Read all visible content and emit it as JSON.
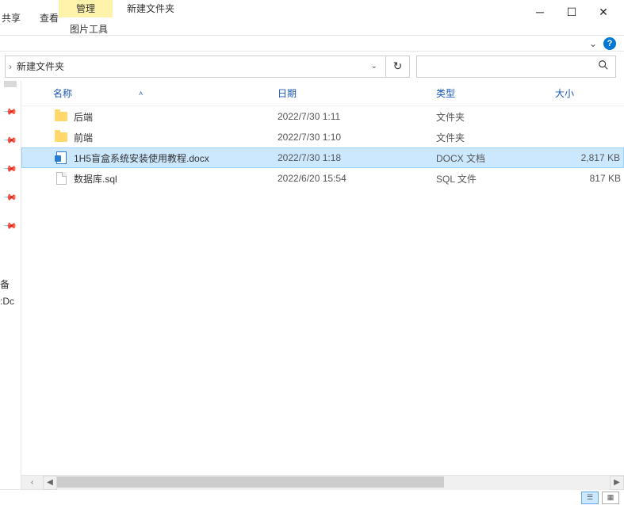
{
  "title_bar": {
    "manage": "管理",
    "window_title": "新建文件夹",
    "share": "共享",
    "view": "查看",
    "picture_tools": "图片工具"
  },
  "breadcrumb": {
    "current": "新建文件夹"
  },
  "columns": {
    "name": "名称",
    "date": "日期",
    "type": "类型",
    "size": "大小"
  },
  "files": [
    {
      "name": "后端",
      "date": "2022/7/30 1:11",
      "type": "文件夹",
      "size": "",
      "icon": "folder",
      "selected": false
    },
    {
      "name": "前端",
      "date": "2022/7/30 1:10",
      "type": "文件夹",
      "size": "",
      "icon": "folder",
      "selected": false
    },
    {
      "name": "1H5盲盒系统安装使用教程.docx",
      "date": "2022/7/30 1:18",
      "type": "DOCX 文档",
      "size": "2,817 KB",
      "icon": "docx",
      "selected": true
    },
    {
      "name": "数据库.sql",
      "date": "2022/6/20 15:54",
      "type": "SQL 文件",
      "size": "817 KB",
      "icon": "file",
      "selected": false
    }
  ],
  "sidebar_stubs": {
    "a": "备",
    "b": ":Dc"
  }
}
